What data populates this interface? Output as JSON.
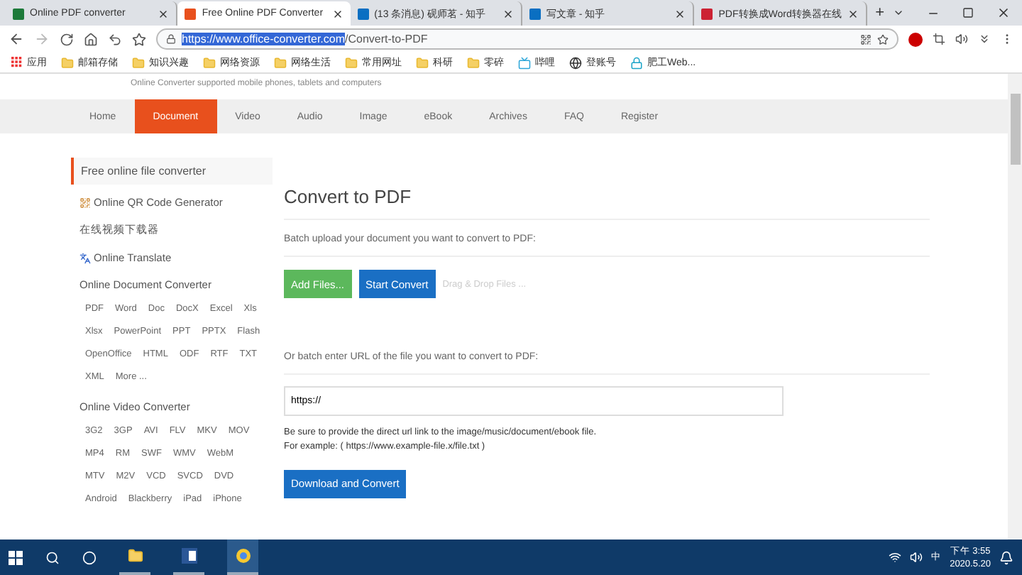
{
  "tabs": [
    {
      "label": "Online PDF converter",
      "selected": false
    },
    {
      "label": "Free Online PDF Converter",
      "selected": true
    },
    {
      "label": "(13 条消息) 砚师茗 - 知乎",
      "selected": false
    },
    {
      "label": "写文章 - 知乎",
      "selected": false
    },
    {
      "label": "PDF转换成Word转换器在线",
      "selected": false
    }
  ],
  "new_tab": "+",
  "address": {
    "host": "https://www.office-converter.com",
    "path": "/Convert-to-PDF"
  },
  "bookmarks": [
    {
      "label": "应用",
      "kind": "apps"
    },
    {
      "label": "邮箱存储",
      "kind": "folder"
    },
    {
      "label": "知识兴趣",
      "kind": "folder"
    },
    {
      "label": "网络资源",
      "kind": "folder"
    },
    {
      "label": "网络生活",
      "kind": "folder"
    },
    {
      "label": "常用网址",
      "kind": "folder"
    },
    {
      "label": "科研",
      "kind": "folder"
    },
    {
      "label": "零碎",
      "kind": "folder"
    },
    {
      "label": "哔哩",
      "kind": "tv"
    },
    {
      "label": "登账号",
      "kind": "globe"
    },
    {
      "label": "肥工Web...",
      "kind": "lock"
    }
  ],
  "tagline": "Online Converter supported mobile phones, tablets and computers",
  "nav": [
    {
      "label": "Home",
      "selected": false
    },
    {
      "label": "Document",
      "selected": true
    },
    {
      "label": "Video",
      "selected": false
    },
    {
      "label": "Audio",
      "selected": false
    },
    {
      "label": "Image",
      "selected": false
    },
    {
      "label": "eBook",
      "selected": false
    },
    {
      "label": "Archives",
      "selected": false
    },
    {
      "label": "FAQ",
      "selected": false
    },
    {
      "label": "Register",
      "selected": false
    }
  ],
  "sidebar": [
    {
      "kind": "heading",
      "label": "Free online file converter"
    },
    {
      "kind": "qr",
      "label": "Online QR Code Generator"
    },
    {
      "kind": "plain",
      "label": "在线视频下载器"
    },
    {
      "kind": "translate",
      "label": "Online Translate"
    },
    {
      "kind": "section",
      "label": "Online Document Converter"
    },
    {
      "kind": "formats",
      "items": [
        "PDF",
        "Word",
        "Doc",
        "DocX",
        "Excel",
        "Xls",
        "Xlsx",
        "PowerPoint",
        "PPT",
        "PPTX",
        "Flash",
        "OpenOffice",
        "HTML",
        "ODF",
        "RTF",
        "TXT",
        "XML",
        "More ..."
      ]
    },
    {
      "kind": "section",
      "label": "Online Video Converter"
    },
    {
      "kind": "formats",
      "items": [
        "3G2",
        "3GP",
        "AVI",
        "FLV",
        "MKV",
        "MOV",
        "MP4",
        "RM",
        "SWF",
        "WMV",
        "WebM",
        "MTV",
        "M2V",
        "VCD",
        "SVCD",
        "DVD",
        "Android",
        "Blackberry",
        "iPad",
        "iPhone"
      ]
    }
  ],
  "main": {
    "title": "Convert to PDF",
    "upload_prompt": "Batch upload your document you want to convert to PDF:",
    "add_files": "Add Files...",
    "start_convert": "Start Convert",
    "drop_hint": "Drag & Drop Files ...",
    "url_prompt": "Or batch enter URL of the file you want to convert to PDF:",
    "url_value": "https://",
    "help": [
      "Be sure to provide the direct url link to the image/music/document/ebook file.",
      "For example: ( https://www.example-file.x/file.txt )"
    ],
    "download": "Download and Convert"
  },
  "taskbar": {
    "ime": "中",
    "time": "下午 3:55",
    "date": "2020.5.20"
  }
}
